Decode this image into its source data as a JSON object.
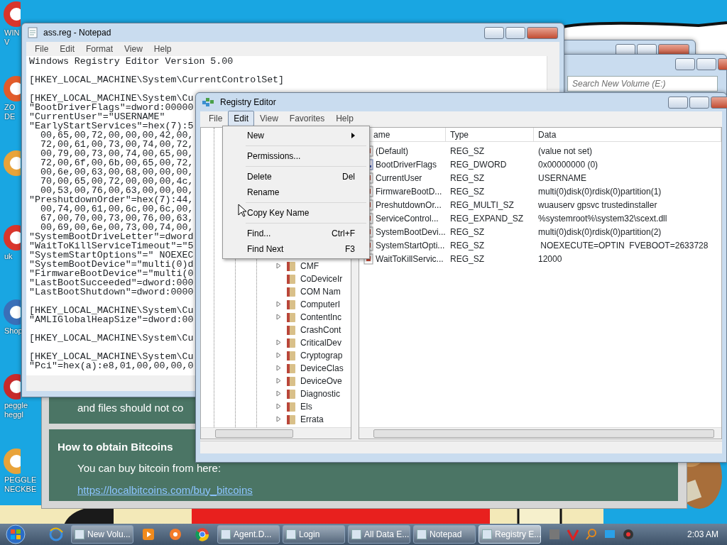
{
  "desktop_icons": [
    {
      "lines": [
        "WIN",
        "V"
      ]
    },
    {
      "lines": [
        "ZO",
        "DE"
      ]
    },
    {
      "kind": "icon"
    },
    {
      "lines": [
        "uk"
      ]
    },
    {
      "lines": [
        "Shop"
      ]
    },
    {
      "lines": [
        "peggle",
        "heggl"
      ]
    },
    {
      "lines": [
        "PEGGLE",
        "NECKBE"
      ]
    }
  ],
  "ransom_window": {
    "sentence": "and files should not co",
    "heading": "How to obtain Bitcoins",
    "text": "You can buy bitcoin from here:",
    "link": "https://localbitcoins.com/buy_bitcoins"
  },
  "explorer": {
    "search": {
      "placeholder": "Search New Volume (E:)"
    }
  },
  "notepad": {
    "title": "ass.reg - Notepad",
    "menu": [
      "File",
      "Edit",
      "Format",
      "View",
      "Help"
    ],
    "blocks": [
      [
        "Windows Registry Editor Version 5.00"
      ],
      [
        "[HKEY_LOCAL_MACHINE\\System\\CurrentControlSet]"
      ],
      [
        "[HKEY_LOCAL_MACHINE\\System\\Cu",
        "\"BootDriverFlags\"=dword:00000",
        "\"CurrentUser\"=\"USERNAME\"",
        "\"EarlyStartServices\"=hex(7):5",
        "  00,65,00,72,00,00,00,42,00,",
        "  72,00,61,00,73,00,74,00,72,",
        "  00,79,00,73,00,74,00,65,00,",
        "  72,00,6f,00,6b,00,65,00,72,",
        "  00,6e,00,63,00,68,00,00,00,",
        "  70,00,65,00,72,00,00,00,4c,",
        "  00,53,00,76,00,63,00,00,00,",
        "\"PreshutdownOrder\"=hex(7):44,",
        "  00,74,00,61,00,6c,00,6c,00,",
        "  67,00,70,00,73,00,76,00,63,",
        "  00,69,00,6e,00,73,00,74,00,",
        "\"SystemBootDriveLetter\"=dword",
        "\"WaitToKillServiceTimeout\"=\"5",
        "\"SystemStartOptions\"=\" NOEXEC",
        "\"SystemBootDevice\"=\"multi(0)d",
        "\"FirmwareBootDevice\"=\"multi(0",
        "\"LastBootSucceeded\"=dword:000",
        "\"LastBootShutdown\"=dword:0000"
      ],
      [
        "[HKEY_LOCAL_MACHINE\\System\\Cu",
        "\"AMLIGlobalHeapSize\"=dword:00"
      ],
      [
        "[HKEY_LOCAL_MACHINE\\System\\Cu"
      ],
      [
        "[HKEY_LOCAL_MACHINE\\System\\Cu",
        "\"Pci\"=hex(a):e8,01,00,00,00,0"
      ]
    ]
  },
  "regedit": {
    "title": "Registry Editor",
    "menu": [
      {
        "label": "File",
        "selected": false
      },
      {
        "label": "Edit",
        "selected": true
      },
      {
        "label": "View",
        "selected": false
      },
      {
        "label": "Favorites",
        "selected": false
      },
      {
        "label": "Help",
        "selected": false
      }
    ],
    "edit_menu": [
      {
        "label": "New",
        "submenu": true,
        "separator_after": true
      },
      {
        "label": "Permissions...",
        "separator_after": true
      },
      {
        "label": "Delete",
        "shortcut": "Del"
      },
      {
        "label": "Rename",
        "separator_after": true
      },
      {
        "label": "Copy Key Name",
        "separator_after": true
      },
      {
        "label": "Find...",
        "shortcut": "Ctrl+F"
      },
      {
        "label": "Find Next",
        "shortcut": "F3"
      }
    ],
    "tree": [
      {
        "label": "CMF",
        "expandable": true
      },
      {
        "label": "CoDeviceIr",
        "expandable": false
      },
      {
        "label": "COM Nam",
        "expandable": false
      },
      {
        "label": "ComputerI",
        "expandable": true
      },
      {
        "label": "ContentInc",
        "expandable": true
      },
      {
        "label": "CrashCont",
        "expandable": false
      },
      {
        "label": "CriticalDev",
        "expandable": true
      },
      {
        "label": "Cryptograp",
        "expandable": true
      },
      {
        "label": "DeviceClas",
        "expandable": true
      },
      {
        "label": "DeviceOve",
        "expandable": true
      },
      {
        "label": "Diagnostic",
        "expandable": true
      },
      {
        "label": "Els",
        "expandable": true
      },
      {
        "label": "Errata",
        "expandable": true
      }
    ],
    "columns": [
      "ame",
      "Type",
      "Data"
    ],
    "values": [
      {
        "kind": "string",
        "name": "(Default)",
        "type": "REG_SZ",
        "data": "(value not set)"
      },
      {
        "kind": "binary",
        "name": "BootDriverFlags",
        "type": "REG_DWORD",
        "data": "0x00000000 (0)"
      },
      {
        "kind": "string",
        "name": "CurrentUser",
        "type": "REG_SZ",
        "data": "USERNAME"
      },
      {
        "kind": "string",
        "name": "FirmwareBootD...",
        "type": "REG_SZ",
        "data": "multi(0)disk(0)rdisk(0)partition(1)"
      },
      {
        "kind": "string",
        "name": "PreshutdownOr...",
        "type": "REG_MULTI_SZ",
        "data": "wuauserv gpsvc trustedinstaller"
      },
      {
        "kind": "string",
        "name": "ServiceControl...",
        "type": "REG_EXPAND_SZ",
        "data": "%systemroot%\\system32\\scext.dll"
      },
      {
        "kind": "string",
        "name": "SystemBootDevi...",
        "type": "REG_SZ",
        "data": "multi(0)disk(0)rdisk(0)partition(2)"
      },
      {
        "kind": "string",
        "name": "SystemStartOpti...",
        "type": "REG_SZ",
        "data": " NOEXECUTE=OPTIN  FVEBOOT=2633728"
      },
      {
        "kind": "string",
        "name": "WaitToKillServic...",
        "type": "REG_SZ",
        "data": "12000"
      }
    ]
  },
  "taskbar": {
    "windows": [
      {
        "label": "New Volu...",
        "selected": false
      },
      {
        "label": "Agent.D...",
        "selected": false
      },
      {
        "label": "Login",
        "selected": false
      },
      {
        "label": "All Data E...",
        "selected": false
      },
      {
        "label": "Notepad",
        "selected": false
      },
      {
        "label": "Registry E...",
        "selected": true
      }
    ],
    "clock": "2:03 AM"
  }
}
